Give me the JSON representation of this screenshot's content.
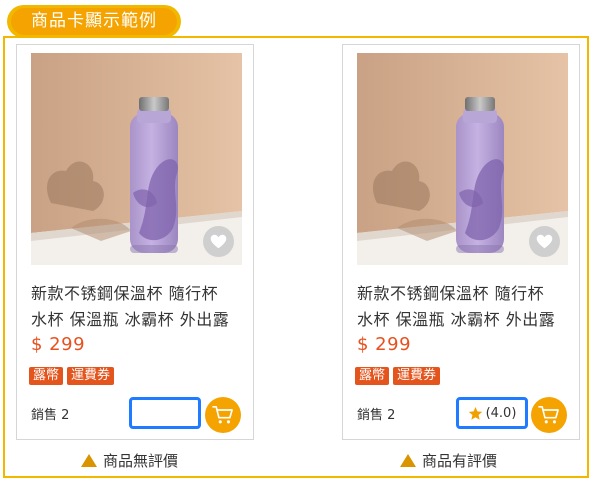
{
  "header": {
    "title": "商品卡顯示範例"
  },
  "colors": {
    "frame": "#f2b800",
    "accent_orange": "#f4a300",
    "price": "#e8501e",
    "tag": "#e4551e",
    "highlight_blue": "#1f7bff",
    "star": "#f0a000"
  },
  "cards": [
    {
      "name_line1": "新款不锈鋼保溫杯 隨行杯",
      "name_line2": "水杯 保溫瓶 冰霸杯 外出露",
      "price": "$ 299",
      "tags": [
        "露幣",
        "運費券"
      ],
      "sales": "銷售 2",
      "rating_text": "",
      "has_rating": false,
      "icons": [
        "heart-icon",
        "cart-icon"
      ]
    },
    {
      "name_line1": "新款不锈鋼保溫杯 隨行杯",
      "name_line2": "水杯 保溫瓶 冰霸杯 外出露",
      "price": "$ 299",
      "tags": [
        "露幣",
        "運費券"
      ],
      "sales": "銷售 2",
      "rating_text": "(4.0)",
      "has_rating": true,
      "icons": [
        "star-icon",
        "heart-icon",
        "cart-icon"
      ]
    }
  ],
  "captions": {
    "left": "商品無評價",
    "right": "商品有評價"
  }
}
